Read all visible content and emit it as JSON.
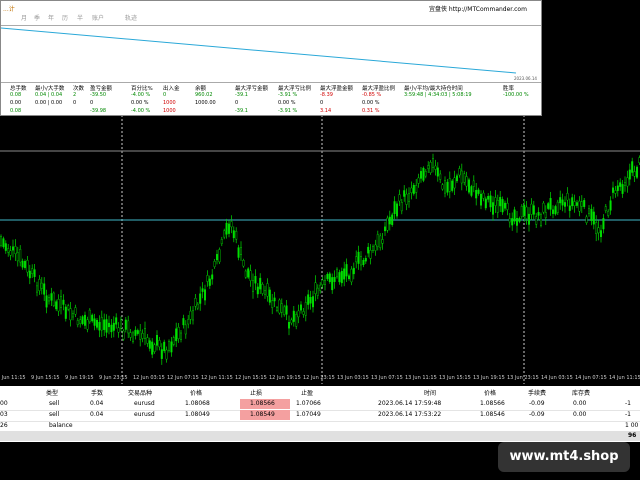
{
  "colors": {
    "candle": "#00e000",
    "grid": "#ffffff",
    "hline_upper": "#8a8a8a",
    "hline_cyan": "#3fb8c8",
    "stop": "#f4a0a0"
  },
  "panel": {
    "menu_items": [
      "...计",
      "月",
      "季",
      "年",
      "历",
      "半",
      "账户",
      "轨迹"
    ],
    "title_right": "宜盘侠 http://MTCommander.com",
    "chart_date": "2023.06.14",
    "headers": [
      "总手数",
      "最小/大手数",
      "次数",
      "盈亏金额",
      "百分比%",
      "出入金",
      "余额",
      "最大浮亏金额",
      "最大浮亏比例",
      "最大浮盈金额",
      "最大浮盈比例",
      "最小/平均/最大持仓时间",
      "胜率"
    ],
    "rows": [
      [
        "0.08",
        "0.04 | 0.04",
        "2",
        "-39.50",
        "-4.00 %",
        "0",
        "960.02",
        "-39.1",
        "-3.91 %",
        "-8.39",
        "-0.85 %",
        "3:59:48 | 4:34:03 | 5:08:19",
        "-100.00 %"
      ],
      [
        "0.00",
        "0.00 | 0.00",
        "0",
        "0",
        "0.00 %",
        "1000",
        "1000.00",
        "0",
        "0.00 %",
        "0",
        "0.00 %",
        "",
        ""
      ],
      [
        "0.08",
        "",
        "",
        "-39.98",
        "-4.00 %",
        "1000",
        "",
        "-39.1",
        "-3.91 %",
        "3.14",
        "0.31 %",
        "",
        ""
      ]
    ]
  },
  "x_axis_labels": [
    "9 Jun 11:15",
    "9 Jun 15:15",
    "9 Jun 19:15",
    "9 Jun 23:15",
    "12 Jun 03:15",
    "12 Jun 07:15",
    "12 Jun 11:15",
    "12 Jun 15:15",
    "12 Jun 19:15",
    "12 Jun 23:15",
    "13 Jun 03:15",
    "13 Jun 07:15",
    "13 Jun 11:15",
    "13 Jun 15:15",
    "13 Jun 19:15",
    "13 Jun 23:15",
    "14 Jun 03:15",
    "14 Jun 07:15",
    "14 Jun 11:15"
  ],
  "table": {
    "headers": [
      "类型",
      "手数",
      "交易品种",
      "价格",
      "止损",
      "止盈",
      "时间",
      "价格",
      "手续费",
      "库存费"
    ],
    "rows": [
      {
        "id": "00",
        "type": "sell",
        "lots": "0.04",
        "symbol": "eurusd",
        "price": "1.08068",
        "sl": "1.08566",
        "tp": "1.07066",
        "time": "2023.06.14 17:59:48",
        "close_price": "1.08566",
        "commission": "-0.09",
        "swap": "0.00",
        "profit": "-1"
      },
      {
        "id": "03",
        "type": "sell",
        "lots": "0.04",
        "symbol": "eurusd",
        "price": "1.08049",
        "sl": "1.08549",
        "tp": "1.07049",
        "time": "2023.06.14 17:53:22",
        "close_price": "1.08546",
        "commission": "-0.09",
        "swap": "0.00",
        "profit": "-1"
      },
      {
        "id": "26",
        "type": "balance",
        "lots": "",
        "symbol": "",
        "price": "",
        "sl": "",
        "tp": "",
        "time": "",
        "close_price": "",
        "commission": "",
        "swap": "",
        "profit": "1 00"
      }
    ],
    "total": "96"
  },
  "watermark": "www.mt4.shop"
}
